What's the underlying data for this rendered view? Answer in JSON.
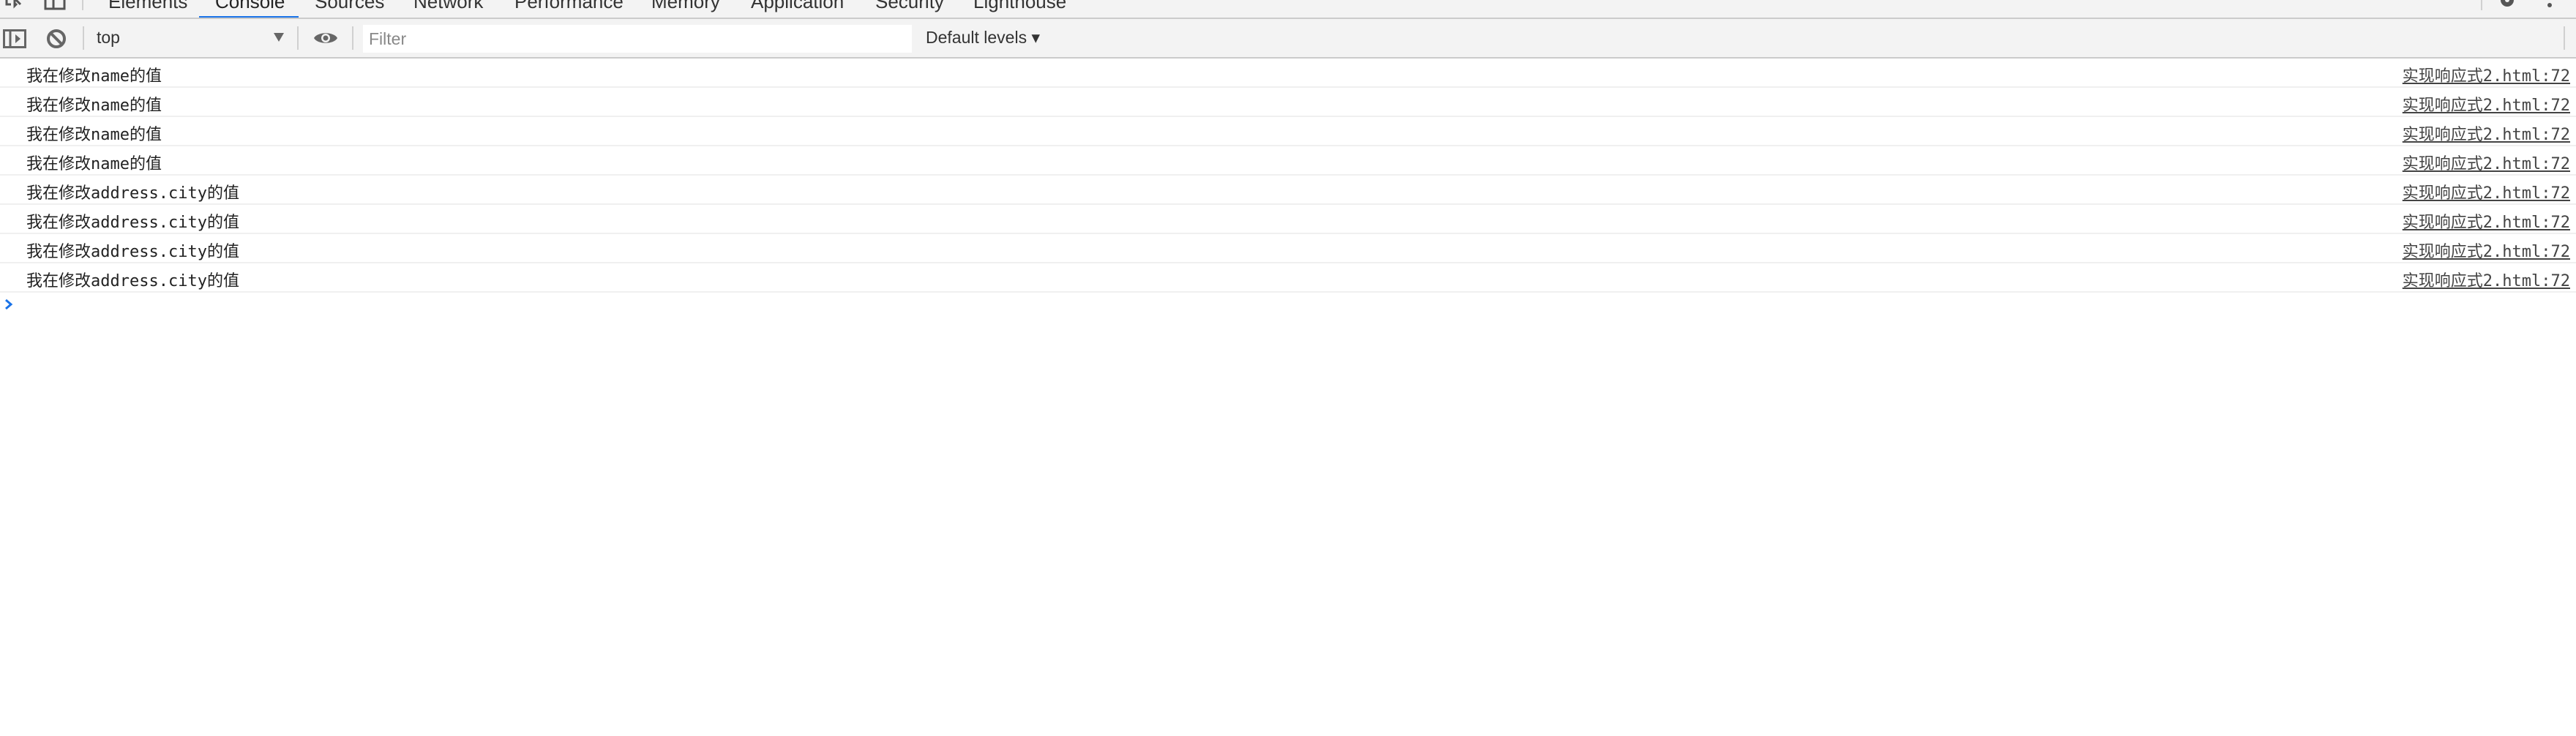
{
  "tabs": [
    {
      "label": "Elements",
      "active": false
    },
    {
      "label": "Console",
      "active": true
    },
    {
      "label": "Sources",
      "active": false
    },
    {
      "label": "Network",
      "active": false
    },
    {
      "label": "Performance",
      "active": false
    },
    {
      "label": "Memory",
      "active": false
    },
    {
      "label": "Application",
      "active": false
    },
    {
      "label": "Security",
      "active": false
    },
    {
      "label": "Lighthouse",
      "active": false
    }
  ],
  "toolbar": {
    "context": "top",
    "filter_placeholder": "Filter",
    "filter_value": "",
    "levels": "Default levels ▾"
  },
  "accent": "#1a73e8",
  "messages": [
    {
      "text": "我在修改name的值",
      "source": "实现响应式2.html:72"
    },
    {
      "text": "我在修改name的值",
      "source": "实现响应式2.html:72"
    },
    {
      "text": "我在修改name的值",
      "source": "实现响应式2.html:72"
    },
    {
      "text": "我在修改name的值",
      "source": "实现响应式2.html:72"
    },
    {
      "text": "我在修改address.city的值",
      "source": "实现响应式2.html:72"
    },
    {
      "text": "我在修改address.city的值",
      "source": "实现响应式2.html:72"
    },
    {
      "text": "我在修改address.city的值",
      "source": "实现响应式2.html:72"
    },
    {
      "text": "我在修改address.city的值",
      "source": "实现响应式2.html:72"
    }
  ]
}
